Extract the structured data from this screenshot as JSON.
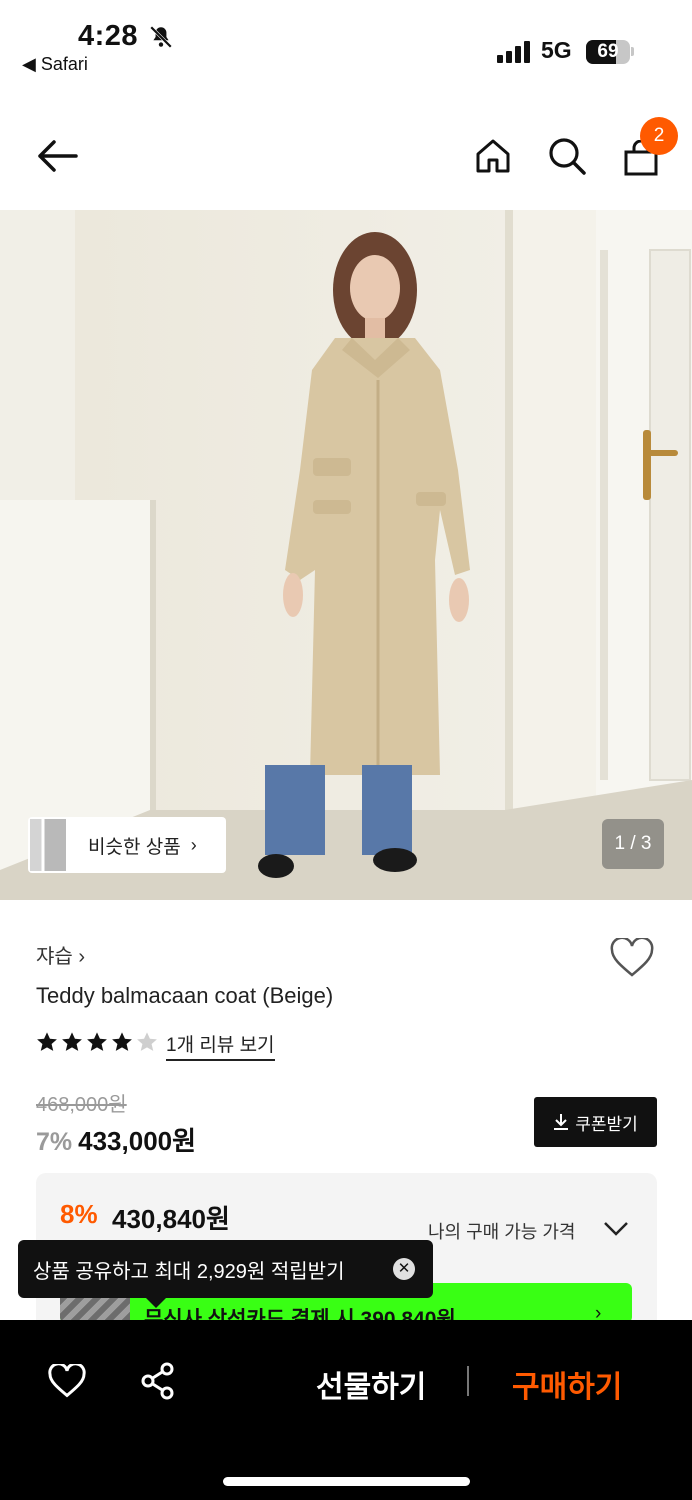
{
  "status_bar": {
    "time": "4:28",
    "back_app": "◀ Safari",
    "network": "5G",
    "battery": "69"
  },
  "header": {
    "cart_count": "2"
  },
  "photo": {
    "similar_label": "비슷한 상품",
    "similar_chevron": "›",
    "pager": "1 / 3"
  },
  "product": {
    "brand": "쟈습 ›",
    "name": "Teddy balmacaan coat (Beige)",
    "rating": 4,
    "review_link": "1개 리뷰 보기",
    "original_price": "468,000원",
    "discount": "7%",
    "price": "433,000원",
    "coupon_button": "쿠폰받기"
  },
  "my_price": {
    "discount": "8%",
    "price": "430,840원",
    "label": "나의 구매 가능 가격",
    "banner_text": "무신사 삼성카드 결제 시 390,840원",
    "banner_chevron": "›"
  },
  "tooltip": {
    "text": "상품 공유하고 최대 2,929원 적립받기",
    "close": "✕"
  },
  "bottom_bar": {
    "gift_label": "선물하기",
    "buy_label": "구매하기"
  },
  "colors": {
    "accent": "#ff5a00",
    "banner_green": "#39ff14",
    "coat": "#d8c6a2"
  }
}
